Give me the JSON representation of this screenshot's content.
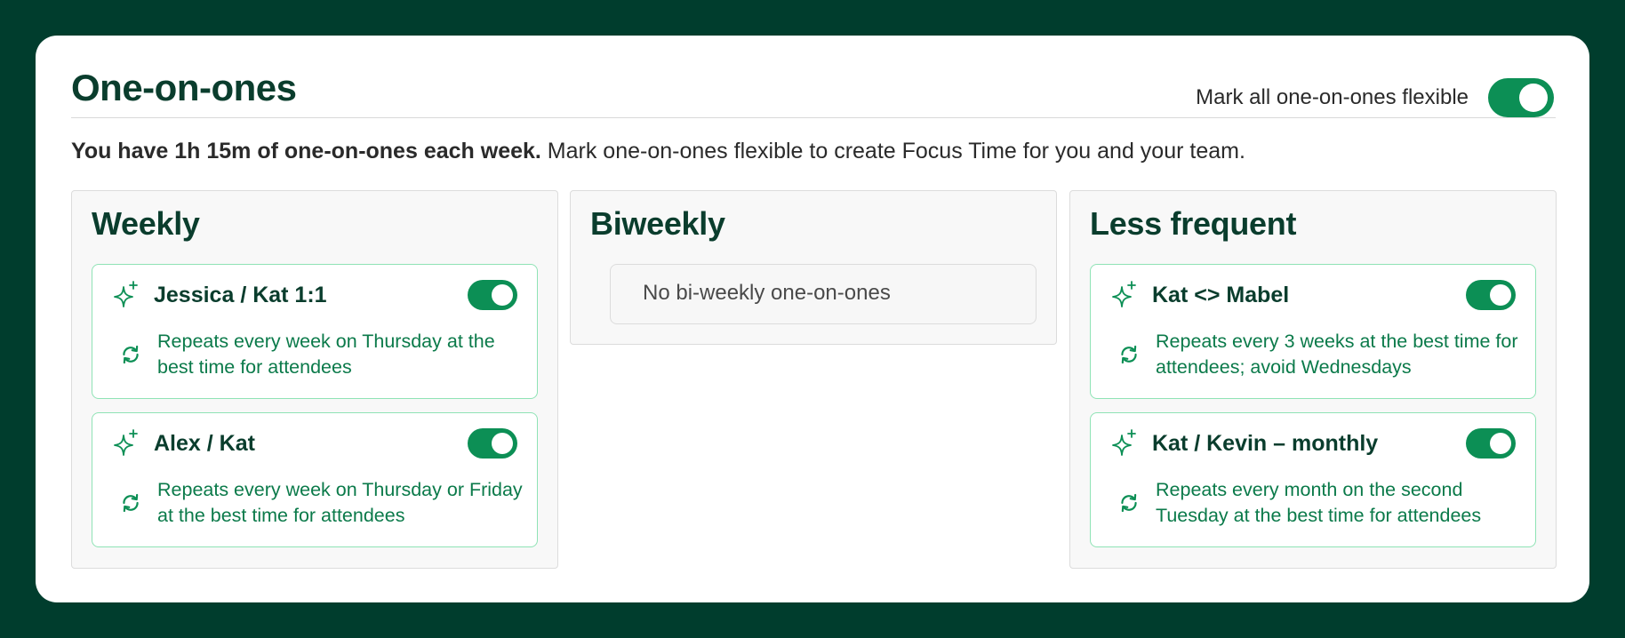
{
  "header": {
    "title": "One-on-ones",
    "toggle_label": "Mark all one-on-ones flexible",
    "toggle_on": true
  },
  "summary": {
    "bold": "You have 1h 15m of one-on-ones each week.",
    "rest": " Mark one-on-ones flexible to create Focus Time for you and your team."
  },
  "columns": {
    "weekly": {
      "title": "Weekly",
      "items": [
        {
          "title": "Jessica / Kat 1:1",
          "description": "Repeats every week on Thursday at the best time for attendees",
          "flexible": true
        },
        {
          "title": "Alex / Kat",
          "description": "Repeats every week on Thursday or Friday at the best time for attendees",
          "flexible": true
        }
      ]
    },
    "biweekly": {
      "title": "Biweekly",
      "empty_text": "No bi-weekly one-on-ones"
    },
    "less_frequent": {
      "title": "Less frequent",
      "items": [
        {
          "title": "Kat <> Mabel",
          "description": "Repeats every 3 weeks at the best time for attendees; avoid Wednesdays",
          "flexible": true
        },
        {
          "title": "Kat / Kevin – monthly",
          "description": "Repeats every month on the second Tuesday at the best time for attendees",
          "flexible": true
        }
      ]
    }
  },
  "icons": {
    "sparkle": "sparkle-icon",
    "repeat": "repeat-icon"
  },
  "colors": {
    "background": "#003d2d",
    "accent": "#0c8f55",
    "heading": "#0a3d2d",
    "description": "#0b7a4a",
    "item_border": "#8fe3b5"
  }
}
